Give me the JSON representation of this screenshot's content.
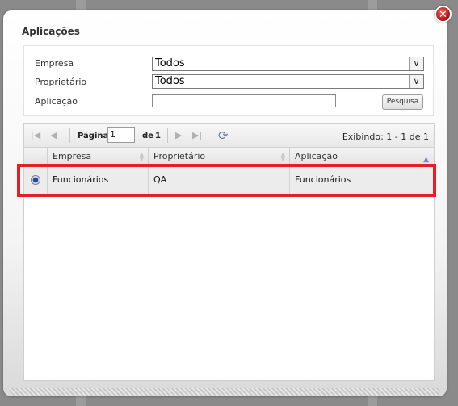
{
  "dialog": {
    "title": "Aplicações",
    "close_symbol": "✕"
  },
  "filters": {
    "empresa_label": "Empresa",
    "empresa_value": "Todos",
    "proprietario_label": "Proprietário",
    "proprietario_value": "Todos",
    "aplicacao_label": "Aplicação",
    "aplicacao_value": "",
    "search_button": "Pesquisa"
  },
  "pager": {
    "page_label": "Página",
    "current_page": "1",
    "of_label": "de",
    "total_pages": "1",
    "showing": "Exibindo: 1 - 1 de 1"
  },
  "table": {
    "columns": [
      "Empresa",
      "Proprietário",
      "Aplicação"
    ],
    "sorted_column": "Aplicação",
    "rows": [
      {
        "selected": true,
        "empresa": "Funcionários",
        "proprietario": "QA",
        "aplicacao": "Funcionários"
      }
    ]
  },
  "colors": {
    "highlight": "#e3202a",
    "close_button": "#c21717"
  }
}
